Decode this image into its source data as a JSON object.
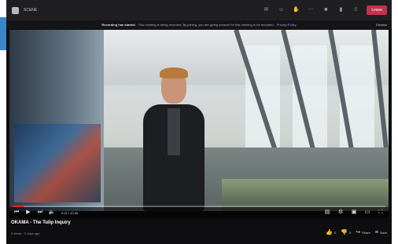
{
  "topbar": {
    "title": "SCENE",
    "leave_label": "Leave"
  },
  "banner": {
    "bold": "Recording has started.",
    "text": "This meeting is being recorded. By joining, you are giving consent for this meeting to be recorded.",
    "link": "Privacy Policy",
    "dismiss": "Dismiss"
  },
  "player": {
    "progress_fraction": 0.03,
    "time": "0:21 / 10:35"
  },
  "video": {
    "title": "OKAMA - The Tulip Inquiry",
    "meta": "0 views · 2 days ago"
  },
  "actions": {
    "likes": "0",
    "dislikes": "0",
    "share": "Share",
    "save": "Save"
  },
  "colors": {
    "accent": "#e62117",
    "leave": "#c4314b",
    "screen_edge": "#3a86c8"
  }
}
